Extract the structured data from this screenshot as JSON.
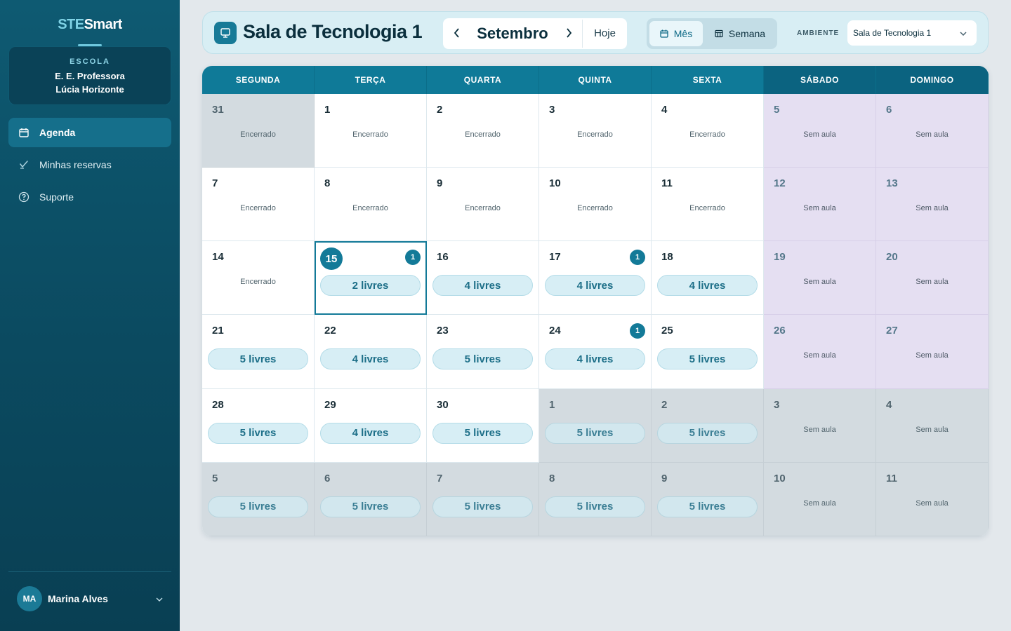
{
  "brand": {
    "part1": "STE",
    "part2": "Smart"
  },
  "school": {
    "label": "ESCOLA",
    "name_line1": "E. E. Professora",
    "name_line2": "Lúcia Horizonte"
  },
  "nav": [
    {
      "label": "Agenda",
      "icon": "calendar-icon",
      "active": true
    },
    {
      "label": "Minhas reservas",
      "icon": "check-icon",
      "active": false
    },
    {
      "label": "Suporte",
      "icon": "help-circle-icon",
      "active": false
    }
  ],
  "user": {
    "initials": "MA",
    "name": "Marina Alves"
  },
  "header": {
    "room_title": "Sala de Tecnologia 1",
    "month": "Setembro",
    "today_label": "Hoje",
    "view_month_label": "Mês",
    "view_week_label": "Semana",
    "active_view": "Mês",
    "ambiente_label": "AMBIENTE",
    "ambiente_value": "Sala de Tecnologia 1"
  },
  "colors": {
    "primary": "#137a98",
    "sidebar": "#0b4a60",
    "weekend": "#e5dff2",
    "outside_month": "#d3dbe0"
  },
  "calendar": {
    "weekdays": [
      "SEGUNDA",
      "TERÇA",
      "QUARTA",
      "QUINTA",
      "SEXTA",
      "SÁBADO",
      "DOMINGO"
    ],
    "days": [
      {
        "n": "31",
        "type": "past-out",
        "status": "Encerrado"
      },
      {
        "n": "1",
        "type": "normal",
        "status": "Encerrado"
      },
      {
        "n": "2",
        "type": "normal",
        "status": "Encerrado"
      },
      {
        "n": "3",
        "type": "normal",
        "status": "Encerrado"
      },
      {
        "n": "4",
        "type": "normal",
        "status": "Encerrado"
      },
      {
        "n": "5",
        "type": "wknd",
        "status": "Sem aula"
      },
      {
        "n": "6",
        "type": "wknd",
        "status": "Sem aula"
      },
      {
        "n": "7",
        "type": "normal",
        "status": "Encerrado"
      },
      {
        "n": "8",
        "type": "normal",
        "status": "Encerrado"
      },
      {
        "n": "9",
        "type": "normal",
        "status": "Encerrado"
      },
      {
        "n": "10",
        "type": "normal",
        "status": "Encerrado"
      },
      {
        "n": "11",
        "type": "normal",
        "status": "Encerrado"
      },
      {
        "n": "12",
        "type": "wknd",
        "status": "Sem aula"
      },
      {
        "n": "13",
        "type": "wknd",
        "status": "Sem aula"
      },
      {
        "n": "14",
        "type": "normal",
        "status": "Encerrado"
      },
      {
        "n": "15",
        "type": "normal",
        "today": true,
        "badge": "1",
        "free": "2 livres"
      },
      {
        "n": "16",
        "type": "normal",
        "free": "4 livres"
      },
      {
        "n": "17",
        "type": "normal",
        "badge": "1",
        "free": "4 livres"
      },
      {
        "n": "18",
        "type": "normal",
        "free": "4 livres"
      },
      {
        "n": "19",
        "type": "wknd",
        "status": "Sem aula"
      },
      {
        "n": "20",
        "type": "wknd",
        "status": "Sem aula"
      },
      {
        "n": "21",
        "type": "normal",
        "free": "5 livres"
      },
      {
        "n": "22",
        "type": "normal",
        "free": "4 livres"
      },
      {
        "n": "23",
        "type": "normal",
        "free": "5 livres"
      },
      {
        "n": "24",
        "type": "normal",
        "badge": "1",
        "free": "4 livres"
      },
      {
        "n": "25",
        "type": "normal",
        "free": "5 livres"
      },
      {
        "n": "26",
        "type": "wknd",
        "status": "Sem aula"
      },
      {
        "n": "27",
        "type": "wknd",
        "status": "Sem aula"
      },
      {
        "n": "28",
        "type": "normal",
        "free": "5 livres"
      },
      {
        "n": "29",
        "type": "normal",
        "free": "4 livres"
      },
      {
        "n": "30",
        "type": "normal",
        "free": "5 livres"
      },
      {
        "n": "1",
        "type": "out",
        "free": "5 livres"
      },
      {
        "n": "2",
        "type": "out",
        "free": "5 livres"
      },
      {
        "n": "3",
        "type": "out",
        "status": "Sem aula"
      },
      {
        "n": "4",
        "type": "out",
        "status": "Sem aula"
      },
      {
        "n": "5",
        "type": "out",
        "free": "5 livres"
      },
      {
        "n": "6",
        "type": "out",
        "free": "5 livres"
      },
      {
        "n": "7",
        "type": "out",
        "free": "5 livres"
      },
      {
        "n": "8",
        "type": "out",
        "free": "5 livres"
      },
      {
        "n": "9",
        "type": "out",
        "free": "5 livres"
      },
      {
        "n": "10",
        "type": "out",
        "status": "Sem aula"
      },
      {
        "n": "11",
        "type": "out",
        "status": "Sem aula"
      }
    ]
  }
}
